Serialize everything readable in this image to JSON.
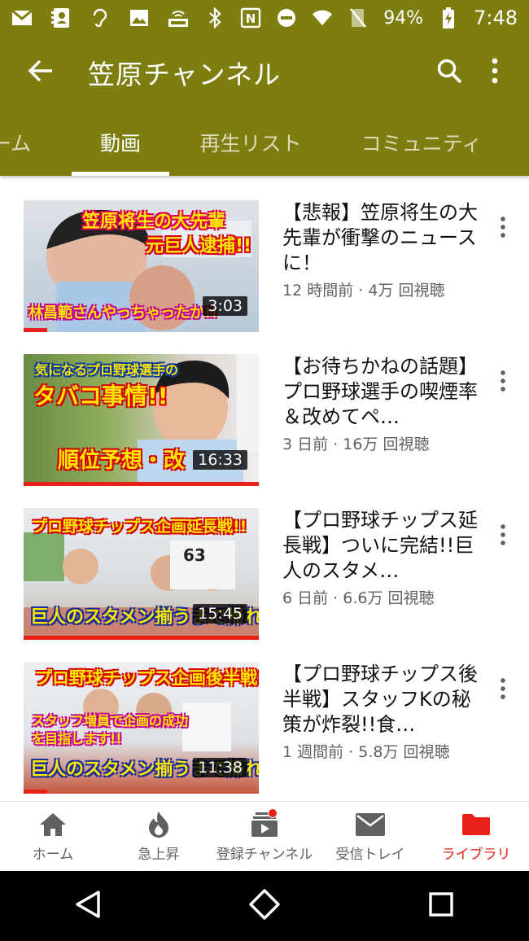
{
  "status_bar": {
    "battery": "94%",
    "time": "7:48"
  },
  "header": {
    "title": "笠原チャンネル"
  },
  "tabs": [
    {
      "label": "ホーム"
    },
    {
      "label": "動画"
    },
    {
      "label": "再生リスト"
    },
    {
      "label": "コミュニティ"
    }
  ],
  "videos": [
    {
      "title": "【悲報】笠原将生の大先輩が衝撃のニュースに！",
      "meta": "12 時間前 · 4万 回視聴",
      "duration": "3:03",
      "thumb_text_top": "笠原将生の大先輩",
      "thumb_text_mid": "元巨人逮捕!!",
      "thumb_text_bottom": "林昌範さんやっちゃったか!!"
    },
    {
      "title": "【お待ちかねの話題】プロ野球選手の喫煙率＆改めてペ…",
      "meta": "3 日前 · 16万 回視聴",
      "duration": "16:33",
      "thumb_text_top": "気になるプロ野球選手の",
      "thumb_text_mid": "タバコ事情!!",
      "thumb_text_bottom": "順位予想・改"
    },
    {
      "title": "【プロ野球チップス延長戦】ついに完結!!巨人のスタメ…",
      "meta": "6 日前 · 6.6万 回視聴",
      "duration": "15:45",
      "thumb_text_top": "プロ野球チップス企画延長戦!!",
      "thumb_text_mid": "63",
      "thumb_text_bottom": "巨人のスタメン揃うまで帰れ"
    },
    {
      "title": "【プロ野球チップス後半戦】スタッフKの秘策が炸裂!!食…",
      "meta": "1 週間前 · 5.8万 回視聴",
      "duration": "11:38",
      "thumb_text_top": "プロ野球チップス企画後半戦!!",
      "thumb_text_mid": "スタッフ増員で企画の成功を目指します!!",
      "thumb_text_bottom": "巨人のスタメン揃うまで帰れ"
    }
  ],
  "bottom_nav": [
    {
      "label": "ホーム",
      "icon": "home-icon"
    },
    {
      "label": "急上昇",
      "icon": "flame-icon"
    },
    {
      "label": "登録チャンネル",
      "icon": "subscriptions-icon"
    },
    {
      "label": "受信トレイ",
      "icon": "mail-icon"
    },
    {
      "label": "ライブラリ",
      "icon": "folder-icon"
    }
  ],
  "colors": {
    "app_bar": "#7d7d10",
    "accent_red": "#e62117",
    "meta_gray": "#606060"
  }
}
